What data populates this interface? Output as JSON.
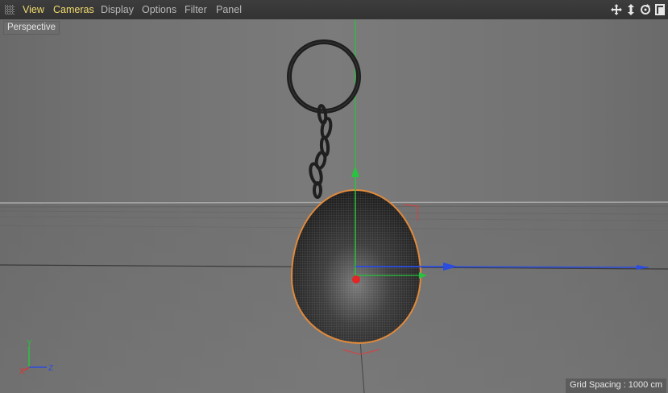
{
  "menubar": {
    "items": [
      {
        "label": "View",
        "active": true
      },
      {
        "label": "Cameras",
        "active": true
      },
      {
        "label": "Display",
        "active": false
      },
      {
        "label": "Options",
        "active": false
      },
      {
        "label": "Filter",
        "active": false
      },
      {
        "label": "Panel",
        "active": false
      }
    ],
    "nav_icons": [
      "move-view-icon",
      "dolly-view-icon",
      "rotate-view-icon",
      "toggle-layout-icon"
    ]
  },
  "viewport": {
    "label": "Perspective",
    "grid_spacing": "Grid Spacing : 1000 cm",
    "gizmo_axes": {
      "y": "Y",
      "x": "X",
      "z": "Z"
    }
  },
  "colors": {
    "active_menu": "#f2dc6e",
    "menu_text": "#b9b9b9",
    "selection_outline": "#e08a3c",
    "axis_x": "#e03030",
    "axis_y": "#20c040",
    "axis_z": "#2a4ce0"
  }
}
